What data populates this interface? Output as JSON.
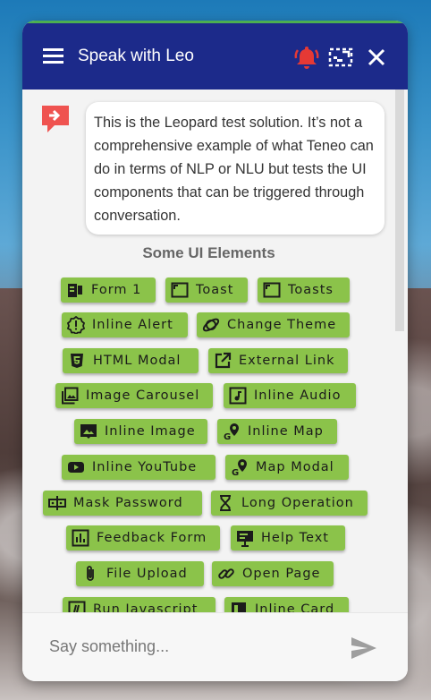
{
  "header": {
    "title": "Speak with Leo"
  },
  "message": {
    "text": "This is the Leopard test solution. It’s not a comprehensive example of what Teneo can do in terms of NLP or NLU but tests the UI components that can be triggered through conversation."
  },
  "ui_elements": {
    "title": "Some UI Elements",
    "buttons": [
      {
        "label": "Form 1",
        "icon": "form-icon"
      },
      {
        "label": "Toast",
        "icon": "toast-icon"
      },
      {
        "label": "Toasts",
        "icon": "toasts-icon"
      },
      {
        "label": "Inline Alert",
        "icon": "alert-icon"
      },
      {
        "label": "Change Theme",
        "icon": "theme-icon"
      },
      {
        "label": "HTML Modal",
        "icon": "html5-icon"
      },
      {
        "label": "External Link",
        "icon": "external-link-icon"
      },
      {
        "label": "Image Carousel",
        "icon": "carousel-icon"
      },
      {
        "label": "Inline Audio",
        "icon": "audio-icon"
      },
      {
        "label": "Inline Image",
        "icon": "image-icon"
      },
      {
        "label": "Inline Map",
        "icon": "map-icon"
      },
      {
        "label": "Inline YouTube",
        "icon": "youtube-icon"
      },
      {
        "label": "Map Modal",
        "icon": "map-modal-icon"
      },
      {
        "label": "Mask Password",
        "icon": "password-icon"
      },
      {
        "label": "Long Operation",
        "icon": "hourglass-icon"
      },
      {
        "label": "Feedback Form",
        "icon": "feedback-icon"
      },
      {
        "label": "Help Text",
        "icon": "help-text-icon"
      },
      {
        "label": "File Upload",
        "icon": "attachment-icon"
      },
      {
        "label": "Open Page",
        "icon": "link-icon"
      },
      {
        "label": "Run Javascript",
        "icon": "javascript-icon"
      },
      {
        "label": "Inline Card",
        "icon": "card-icon"
      }
    ]
  },
  "input": {
    "placeholder": "Say something..."
  },
  "colors": {
    "header": "#1c2a8a",
    "button": "#8bc34a",
    "bell": "#e53935"
  }
}
